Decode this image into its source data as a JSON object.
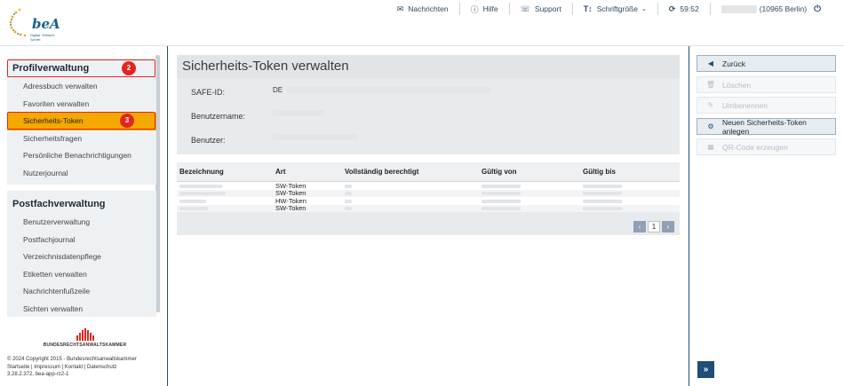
{
  "header": {
    "logo_text": "beA",
    "logo_subtitle": "Digital. Einfach. Sicher.",
    "nav": [
      {
        "icon": "envelope-icon",
        "label": "Nachrichten"
      },
      {
        "icon": "help-icon",
        "label": "Hilfe"
      },
      {
        "icon": "support-icon",
        "label": "Support"
      },
      {
        "icon": "font-size-icon",
        "label": "Schriftgröße"
      },
      {
        "icon": "refresh-icon",
        "label": "59:52"
      }
    ],
    "user_location": "(10965 Berlin)"
  },
  "sidebar": {
    "profile_heading": "Profilverwaltung",
    "profile_items": [
      "Adressbuch verwalten",
      "Favoriten verwalten",
      "Sicherheits-Token",
      "Sicherheitsfragen",
      "Persönliche Benachrichtigungen",
      "Nutzerjournal"
    ],
    "postfach_heading": "Postfachverwaltung",
    "postfach_items": [
      "Benutzerverwaltung",
      "Postfachjournal",
      "Verzeichnisdatenpflege",
      "Etiketten verwalten",
      "Nachrichtenfußzeile",
      "Sichten verwalten"
    ],
    "badge_profile": "2",
    "badge_token": "3",
    "brak_name": "BUNDESRECHTSANWALTSKAMMER",
    "footer_copyright": "© 2024 Copyright 2015 - Bundesrechtsanwaltskammer",
    "footer_links": "Startseite | Impressum | Kontakt | Datenschutz",
    "footer_version": "3.28.2.372, bea-app-rz2-1"
  },
  "main": {
    "title": "Sicherheits-Token verwalten",
    "safe_id_label": "SAFE-ID:",
    "safe_id_prefix": "DE",
    "username_label": "Benutzername:",
    "user_label": "Benutzer:",
    "table": {
      "columns": [
        "Bezeichnung",
        "Art",
        "Vollständig berechtigt",
        "Gültig von",
        "Gültig bis"
      ],
      "rows": [
        {
          "art": "SW-Token"
        },
        {
          "art": "SW-Token"
        },
        {
          "art": "HW-Token"
        },
        {
          "art": "SW-Token"
        }
      ]
    },
    "pager_page": "1"
  },
  "actions": [
    {
      "icon": "back-icon",
      "label": "Zurück",
      "enabled": true
    },
    {
      "icon": "trash-icon",
      "label": "Löschen",
      "enabled": false
    },
    {
      "icon": "edit-icon",
      "label": "Umbenennen",
      "enabled": false
    },
    {
      "icon": "gear-icon",
      "label": "Neuen Sicherheits-Token anlegen",
      "enabled": true
    },
    {
      "icon": "qr-code-icon",
      "label": "QR-Code erzeugen",
      "enabled": false
    }
  ],
  "colors": {
    "primary": "#1e4e79",
    "active": "#f5a800",
    "highlight": "#e2261f"
  }
}
